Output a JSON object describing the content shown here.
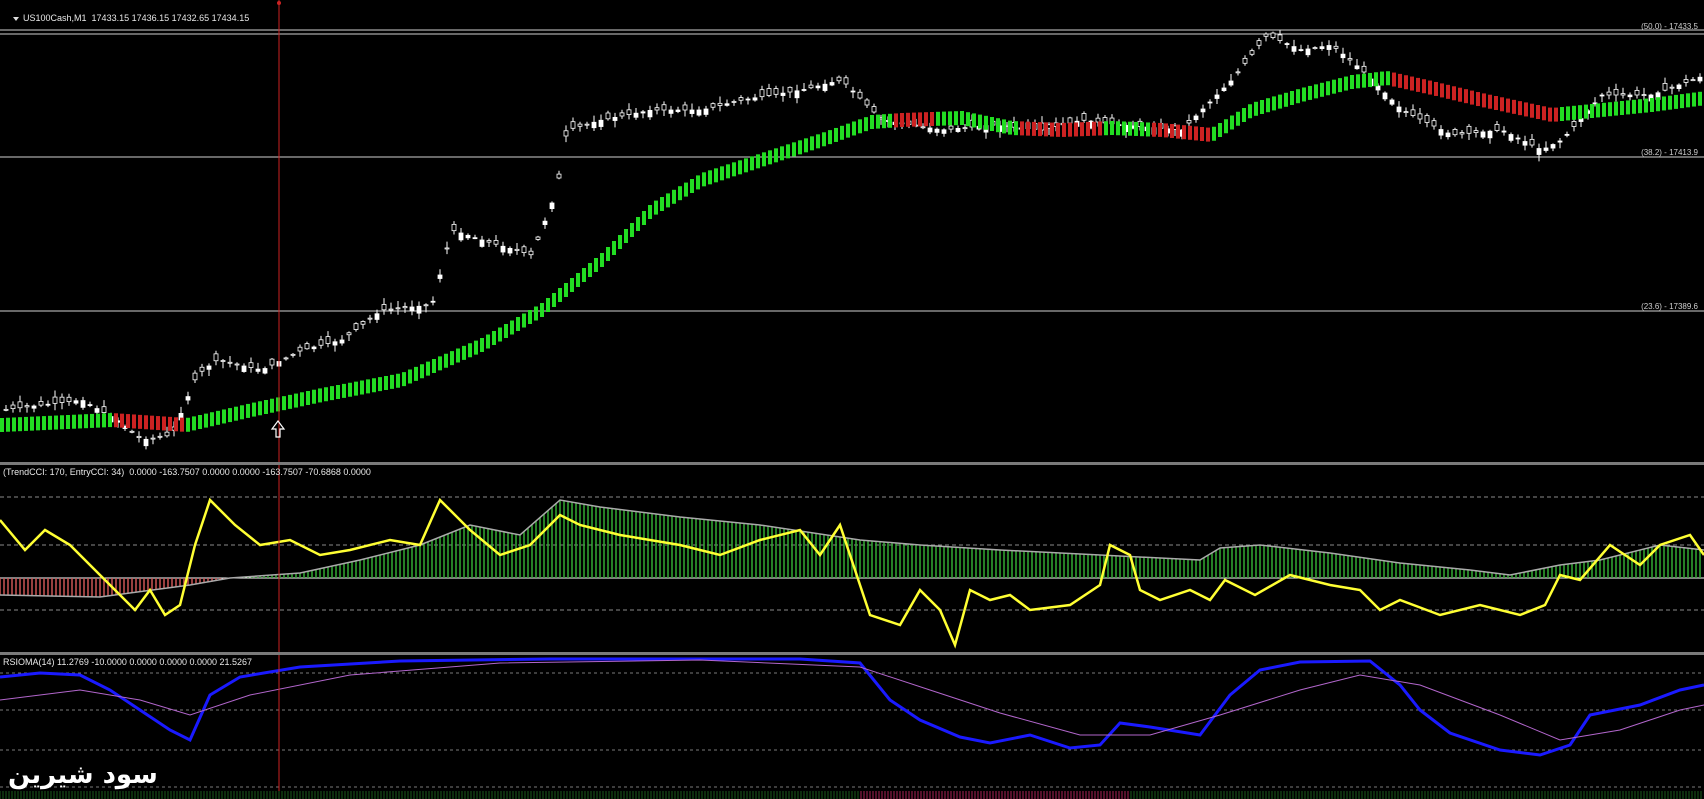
{
  "main_chart": {
    "symbol_header": "US100Cash,M1  17433.15 17436.15 17432.65 17434.15",
    "fib_levels": [
      {
        "label": "(50.0) - 17433.5"
      },
      {
        "label": "(38.2) - 17413.9"
      },
      {
        "label": "(23.6) - 17389.6"
      }
    ],
    "arrow_icon": "up-arrow-icon",
    "colors": {
      "bull": "#ffffff",
      "bear": "#000000",
      "trend_up": "#22dd22",
      "trend_down": "#cc2222",
      "vline": "#cc2222"
    }
  },
  "cci_indicator": {
    "header": "(TrendCCI: 170, EntryCCI: 34)  0.0000 -163.7507 0.0000 0.0000 -163.7507 -70.6868 0.0000",
    "colors": {
      "entry_line": "#ffff33",
      "hist_pos": "#33aa33",
      "hist_neg": "#cc5555",
      "trend_line": "#aaaaaa"
    }
  },
  "rsioma_indicator": {
    "header": "RSIOMA(14) 11.2769 -10.0000 0.0000 0.0000 0.0000 21.5267",
    "colors": {
      "rsi_line": "#1a1aff",
      "signal_line": "#b266cc"
    }
  },
  "watermark": {
    "text": "سود شیرین"
  }
}
